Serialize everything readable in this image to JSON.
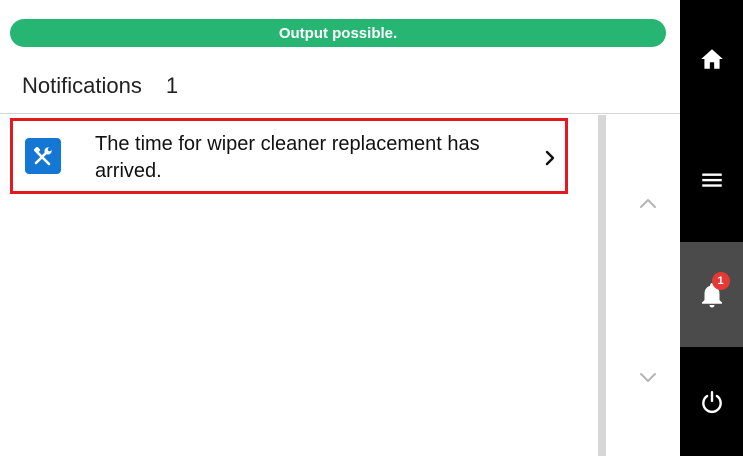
{
  "status_bar": {
    "text": "Output possible.",
    "color": "#27b574"
  },
  "header": {
    "title": "Notifications",
    "count": "1"
  },
  "notifications": [
    {
      "icon": "tools-icon",
      "text": "The time for wiper cleaner replacement has arrived.",
      "highlight_color": "#e2191e"
    }
  ],
  "scroll": {
    "up_icon": "chevron-up-icon",
    "down_icon": "chevron-down-icon"
  },
  "nav": {
    "items": [
      {
        "name": "home",
        "icon": "home-icon"
      },
      {
        "name": "menu",
        "icon": "hamburger-menu-icon"
      },
      {
        "name": "notifications",
        "icon": "bell-icon",
        "badge": "1",
        "active": true
      },
      {
        "name": "power",
        "icon": "power-icon"
      }
    ],
    "background": "#000000",
    "active_background": "#4b4b4b"
  }
}
